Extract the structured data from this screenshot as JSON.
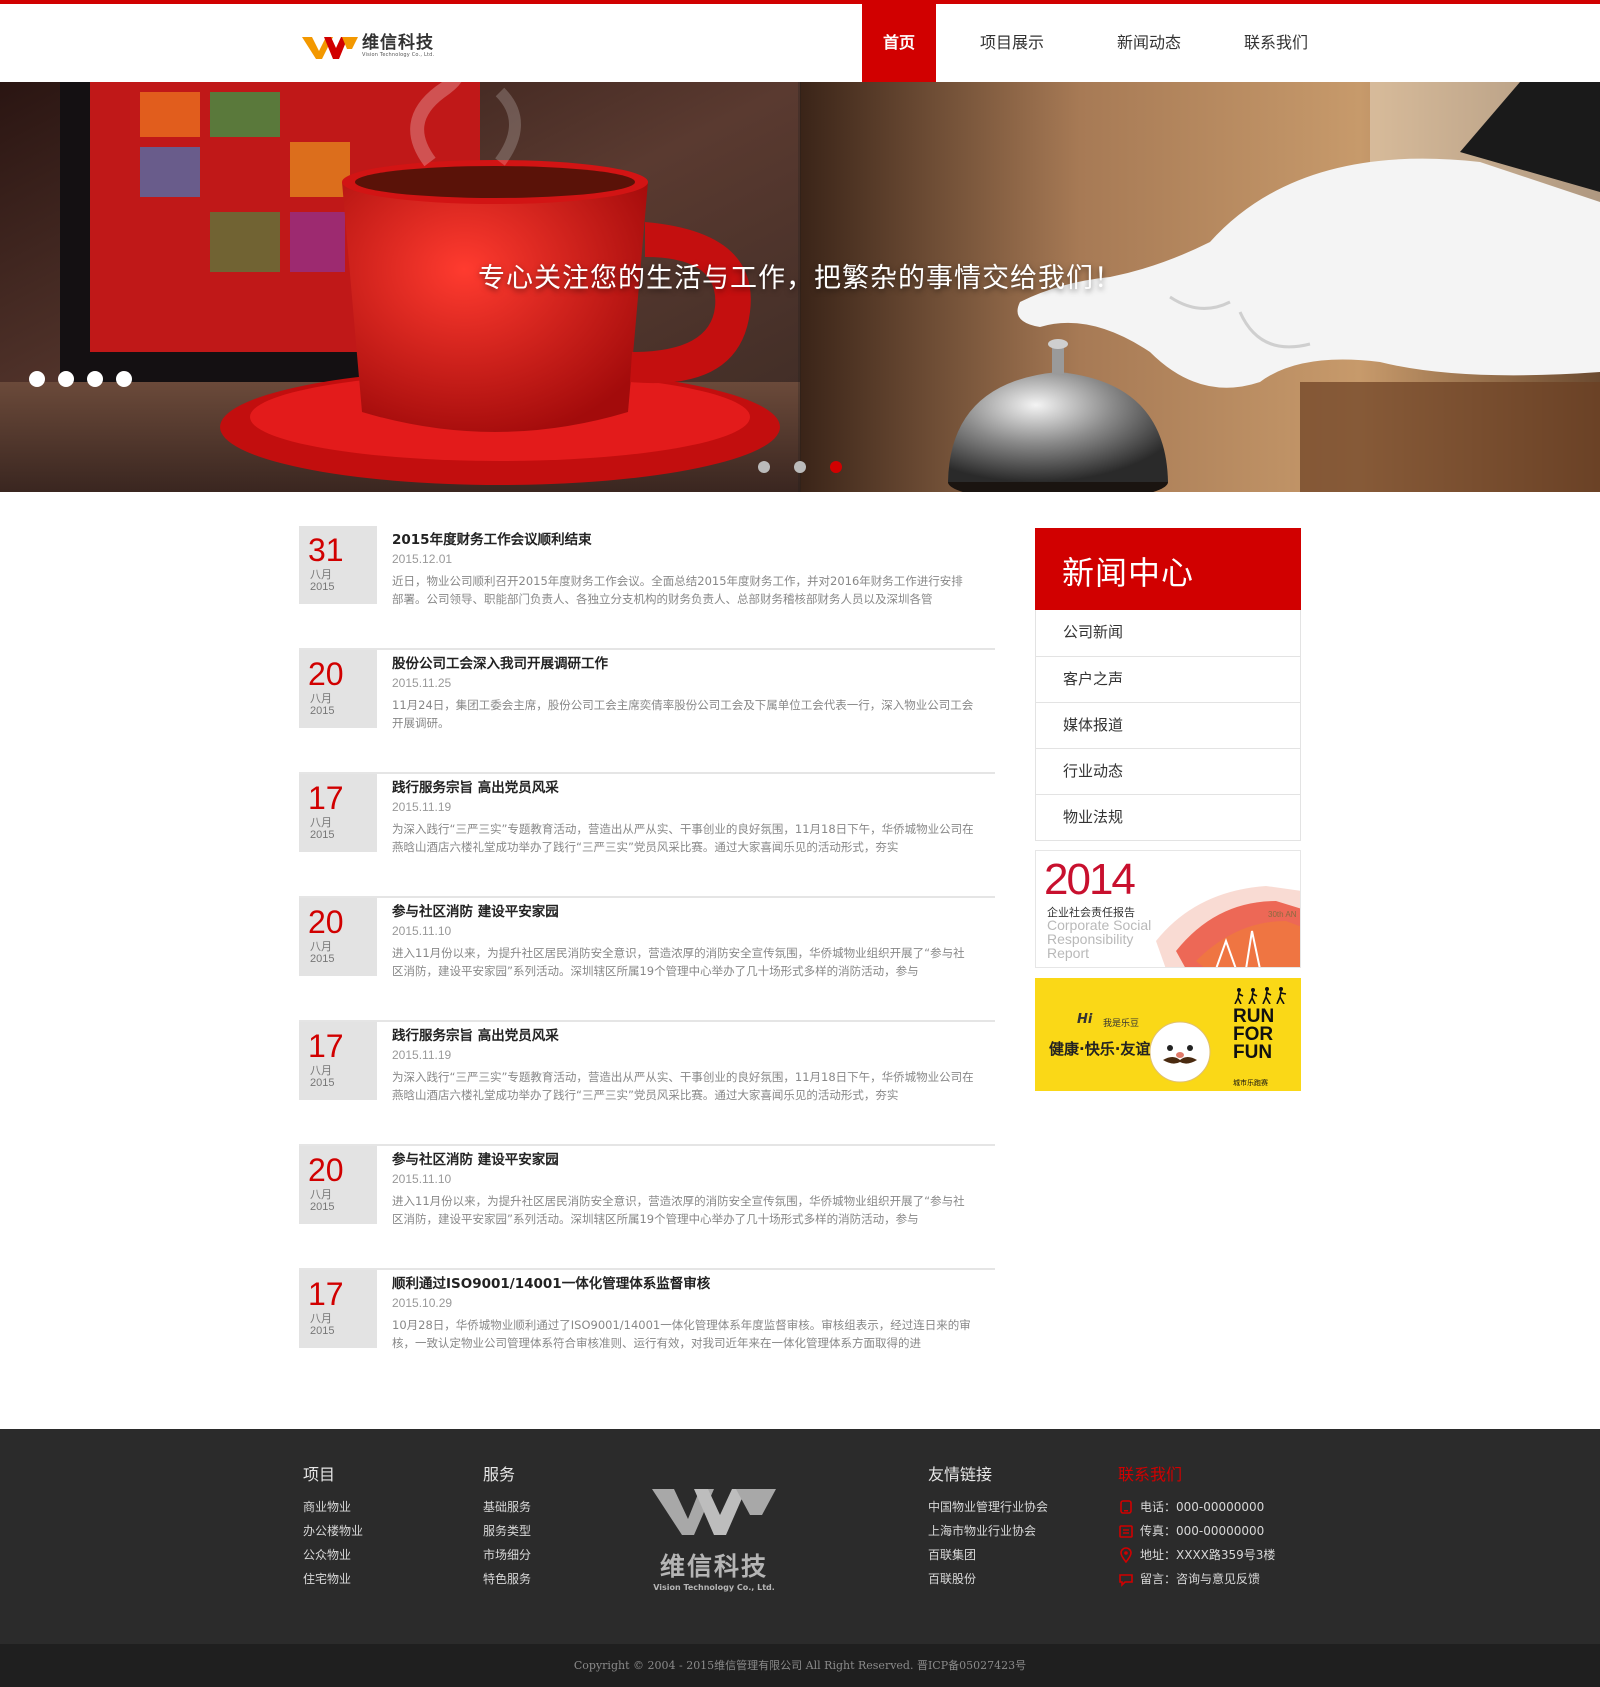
{
  "header": {
    "logo_cn": "维信科技",
    "logo_en": "Vision Technology Co., Ltd.",
    "nav": [
      "首页",
      "项目展示",
      "新闻动态",
      "联系我们"
    ]
  },
  "banner": {
    "slogan": "专心关注您的生活与工作，把繁杂的事情交给我们！"
  },
  "news": [
    {
      "day": "31",
      "month": "八月",
      "year": "2015",
      "title": "2015年度财务工作会议顺利结束",
      "date": "2015.12.01",
      "desc": "近日，物业公司顺利召开2015年度财务工作会议。全面总结2015年度财务工作，并对2016年财务工作进行安排部署。公司领导、职能部门负责人、各独立分支机构的财务负责人、总部财务稽核部财务人员以及深圳各管"
    },
    {
      "day": "20",
      "month": "八月",
      "year": "2015",
      "title": "股份公司工会深入我司开展调研工作",
      "date": "2015.11.25",
      "desc": "11月24日，集团工委会主席，股份公司工会主席奕倩率股份公司工会及下属单位工会代表一行，深入物业公司工会开展调研。"
    },
    {
      "day": "17",
      "month": "八月",
      "year": "2015",
      "title": "践行服务宗旨 高出党员风采",
      "date": "2015.11.19",
      "desc": "为深入践行“三严三实”专题教育活动，营造出从严从实、干事创业的良好氛围，11月18日下午，华侨城物业公司在燕晗山酒店六楼礼堂成功举办了践行“三严三实”党员风采比赛。通过大家喜闻乐见的活动形式，夯实"
    },
    {
      "day": "20",
      "month": "八月",
      "year": "2015",
      "title": "参与社区消防 建设平安家园",
      "date": "2015.11.10",
      "desc": "进入11月份以来，为提升社区居民消防安全意识，营造浓厚的消防安全宣传氛围，华侨城物业组织开展了“参与社区消防，建设平安家园”系列活动。深圳辖区所属19个管理中心举办了几十场形式多样的消防活动，参与"
    },
    {
      "day": "17",
      "month": "八月",
      "year": "2015",
      "title": "践行服务宗旨 高出党员风采",
      "date": "2015.11.19",
      "desc": "为深入践行“三严三实”专题教育活动，营造出从严从实、干事创业的良好氛围，11月18日下午，华侨城物业公司在燕晗山酒店六楼礼堂成功举办了践行“三严三实”党员风采比赛。通过大家喜闻乐见的活动形式，夯实"
    },
    {
      "day": "20",
      "month": "八月",
      "year": "2015",
      "title": "参与社区消防 建设平安家园",
      "date": "2015.11.10",
      "desc": "进入11月份以来，为提升社区居民消防安全意识，营造浓厚的消防安全宣传氛围，华侨城物业组织开展了“参与社区消防，建设平安家园”系列活动。深圳辖区所属19个管理中心举办了几十场形式多样的消防活动，参与"
    },
    {
      "day": "17",
      "month": "八月",
      "year": "2015",
      "title": "顺利通过ISO9001/14001一体化管理体系监督审核",
      "date": "2015.10.29",
      "desc": "10月28日，华侨城物业顺利通过了ISO9001/14001一体化管理体系年度监督审核。审核组表示，经过连日来的审核，一致认定物业公司管理体系符合审核准则、运行有效，对我司近年来在一体化管理体系方面取得的进"
    }
  ],
  "sidebar": {
    "title": "新闻中心",
    "items": [
      "公司新闻",
      "客户之声",
      "媒体报道",
      "行业动态",
      "物业法规"
    ],
    "ad1": {
      "year": "2014",
      "cn": "企业社会责任报告",
      "en": "Corporate Social Responsibility Report",
      "tag": "30th AN"
    },
    "ad2": {
      "hi": "Hi",
      "small": "我是乐豆",
      "slogan": "健康·快乐·友谊",
      "run": [
        "RUN",
        "FOR",
        "FUN"
      ],
      "sub": "城市乐跑赛"
    }
  },
  "footer": {
    "projects": {
      "title": "项目",
      "links": [
        "商业物业",
        "办公楼物业",
        "公众物业",
        "住宅物业"
      ]
    },
    "services": {
      "title": "服务",
      "links": [
        "基础服务",
        "服务类型",
        "市场细分",
        "特色服务"
      ]
    },
    "logo_cn": "维信科技",
    "logo_en": "Vision Technology Co., Ltd.",
    "friends": {
      "title": "友情链接",
      "links": [
        "中国物业管理行业协会",
        "上海市物业行业协会",
        "百联集团",
        "百联股份"
      ]
    },
    "contact": {
      "title": "联系我们",
      "items": [
        {
          "icon": "phone-icon",
          "text": "电话：000-00000000"
        },
        {
          "icon": "fax-icon",
          "text": "传真：000-00000000"
        },
        {
          "icon": "location-icon",
          "text": "地址：XXXX路359号3楼"
        },
        {
          "icon": "message-icon",
          "text": "留言：咨询与意见反馈"
        }
      ]
    },
    "copyright": "Copyright © 2004 - 2015维信管理有限公司  All Right Reserved.   晋ICP备05027423号"
  },
  "colors": {
    "accent": "#d10000",
    "footer_bg": "#2b2b2b",
    "copyright_bg": "#1f1f1f",
    "ad_yellow": "#fad817"
  }
}
